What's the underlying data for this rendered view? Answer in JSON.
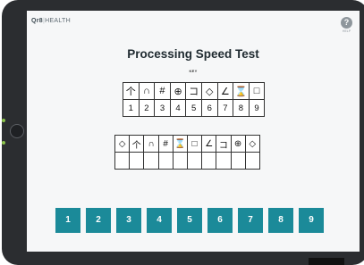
{
  "app": {
    "logo_brand": "Qr8",
    "logo_suffix": "HEALTH",
    "help_icon": "?",
    "help_label": "HELP"
  },
  "test": {
    "title": "Processing Speed Test",
    "key_label": "KEY",
    "key_symbols": [
      "个",
      "∩",
      "#",
      "⊕",
      "コ",
      "◇",
      "∠",
      "⌛",
      "□"
    ],
    "key_numbers": [
      "1",
      "2",
      "3",
      "4",
      "5",
      "6",
      "7",
      "8",
      "9"
    ],
    "test_symbols": [
      "◇",
      "个",
      "∩",
      "#",
      "⌛",
      "□",
      "∠",
      "コ",
      "⊕",
      "◇"
    ],
    "test_answers": [
      "",
      "",
      "",
      "",
      "",
      "",
      "",
      "",
      "",
      ""
    ]
  },
  "keypad": {
    "buttons": [
      "1",
      "2",
      "3",
      "4",
      "5",
      "6",
      "7",
      "8",
      "9"
    ]
  },
  "colors": {
    "accent": "#1b8a99",
    "device": "#2b2d30",
    "screen": "#f6f7f8"
  }
}
